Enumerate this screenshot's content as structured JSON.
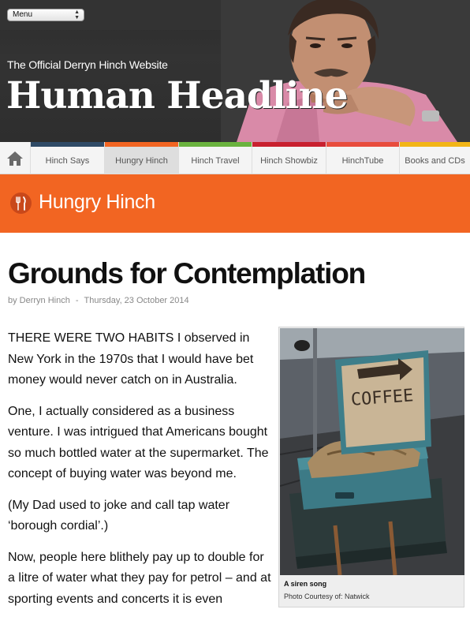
{
  "header": {
    "menu_label": "Menu",
    "site_subtitle": "The Official Derryn Hinch Website",
    "site_title": "Human Headline"
  },
  "nav": {
    "items": [
      {
        "label": "Hinch Says",
        "color": "#2f4a66"
      },
      {
        "label": "Hungry Hinch",
        "color": "#f26522"
      },
      {
        "label": "Hinch Travel",
        "color": "#6ab23e"
      },
      {
        "label": "Hinch Showbiz",
        "color": "#c8202f"
      },
      {
        "label": "HinchTube",
        "color": "#e84c3d"
      },
      {
        "label": "Books and CDs",
        "color": "#f2b517"
      }
    ]
  },
  "category": {
    "title": "Hungry Hinch",
    "color": "#f26522"
  },
  "article": {
    "title": "Grounds for Contemplation",
    "author": "by Derryn Hinch",
    "separator": "-",
    "date": "Thursday, 23 October 2014",
    "paragraphs": [
      "THERE WERE TWO HABITS I observed in New York in the 1970s that I would have bet money would never catch on in Australia.",
      "One, I actually considered as a business venture. I was intrigued that Americans bought so much bottled water at the supermarket. The concept of buying water was beyond me.",
      "(My Dad used to joke and call tap water ‘borough cordial’.)",
      "Now, people here blithely pay up to double for a litre of water what they pay for petrol – and at sporting events and concerts it is even"
    ]
  },
  "figure": {
    "sign_text": "COFFEE",
    "caption_title": "A siren song",
    "caption_credit": "Photo Courtesy of: Natwick"
  }
}
